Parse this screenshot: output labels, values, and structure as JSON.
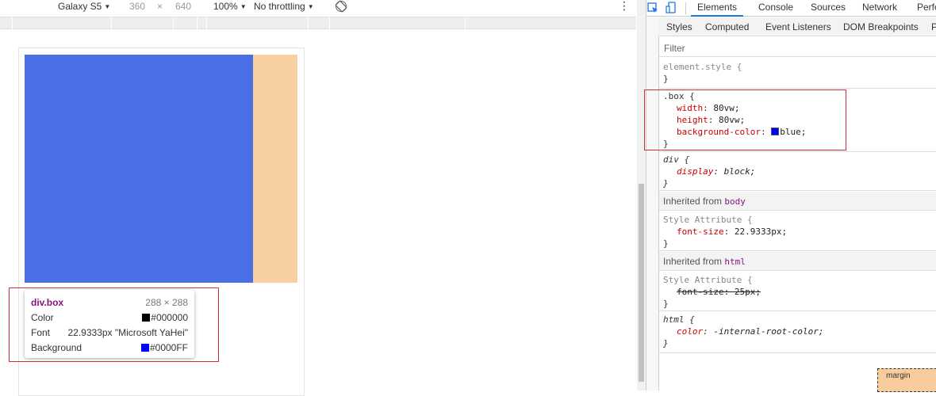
{
  "device_toolbar": {
    "device": "Galaxy S5",
    "width": "360",
    "times": "×",
    "height": "640",
    "zoom": "100%",
    "throttling": "No throttling"
  },
  "colors": {
    "box_blue": "#4a6fe6",
    "box_bg": "#f7cfa0",
    "highlight": "#d0303a",
    "accent": "#1a73e8"
  },
  "tooltip": {
    "title": "div.box",
    "size": "288 × 288",
    "color_label": "Color",
    "color_value": "#000000",
    "font_label": "Font",
    "font_value": "22.9333px \"Microsoft YaHei\"",
    "background_label": "Background",
    "background_value": "#0000FF"
  },
  "devtools": {
    "tabs": [
      "Elements",
      "Console",
      "Sources",
      "Network",
      "Perfo"
    ],
    "subtabs": [
      "Styles",
      "Computed",
      "Event Listeners",
      "DOM Breakpoints",
      "P"
    ],
    "filter_placeholder": "Filter",
    "element_style": {
      "selector": "element.style {",
      "close": "}"
    },
    "box_rule": {
      "selector": ".box {",
      "props": [
        {
          "name": "width",
          "value": "80vw;"
        },
        {
          "name": "height",
          "value": "80vw;"
        },
        {
          "name": "background-color",
          "value": "blue;"
        }
      ],
      "close": "}"
    },
    "div_rule": {
      "selector": "div {",
      "prop": "display",
      "value": "block;",
      "close": "}"
    },
    "inherited_body": {
      "label": "Inherited from",
      "tag": "body"
    },
    "body_style": {
      "selector": "Style Attribute {",
      "prop": "font-size",
      "value": "22.9333px;",
      "close": "}"
    },
    "inherited_html": {
      "label": "Inherited from",
      "tag": "html"
    },
    "html_style": {
      "selector": "Style Attribute {",
      "prop": "font-size",
      "value": "25px;",
      "close": "}"
    },
    "html_rule": {
      "selector": "html {",
      "prop": "color",
      "value": "-internal-root-color;",
      "close": "}"
    },
    "box_model_label": "margin",
    "box_model_dash": "–"
  }
}
